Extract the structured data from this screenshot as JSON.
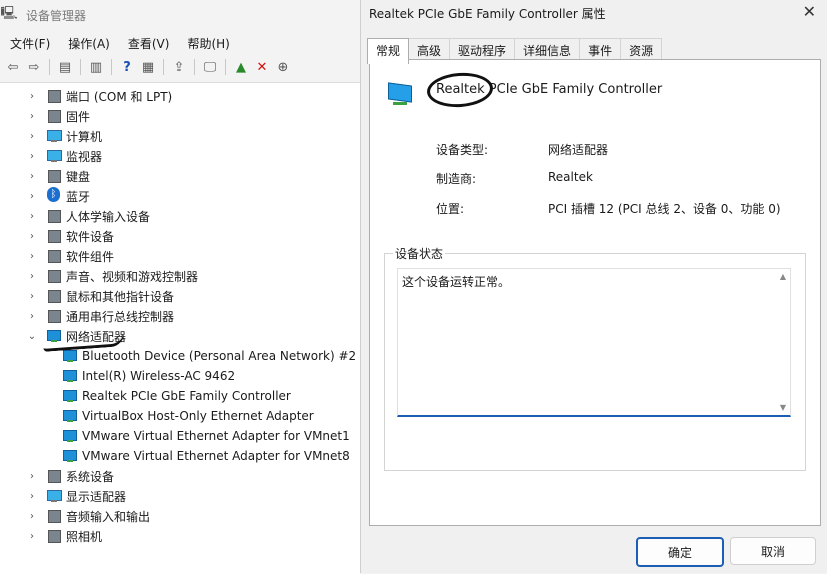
{
  "device_manager": {
    "title": "设备管理器",
    "menu": [
      "文件(F)",
      "操作(A)",
      "查看(V)",
      "帮助(H)"
    ],
    "categories": [
      {
        "label": "端口 (COM 和 LPT)",
        "icon": "port-icon"
      },
      {
        "label": "固件",
        "icon": "firmware-icon"
      },
      {
        "label": "计算机",
        "icon": "computer-icon"
      },
      {
        "label": "监视器",
        "icon": "monitor-icon"
      },
      {
        "label": "键盘",
        "icon": "keyboard-icon"
      },
      {
        "label": "蓝牙",
        "icon": "bluetooth-icon"
      },
      {
        "label": "人体学输入设备",
        "icon": "hid-icon"
      },
      {
        "label": "软件设备",
        "icon": "software-device-icon"
      },
      {
        "label": "软件组件",
        "icon": "software-component-icon"
      },
      {
        "label": "声音、视频和游戏控制器",
        "icon": "audio-icon"
      },
      {
        "label": "鼠标和其他指针设备",
        "icon": "mouse-icon"
      },
      {
        "label": "通用串行总线控制器",
        "icon": "usb-icon"
      },
      {
        "label": "网络适配器",
        "icon": "network-adapter-icon"
      },
      {
        "label": "系统设备",
        "icon": "system-device-icon"
      },
      {
        "label": "显示适配器",
        "icon": "display-adapter-icon"
      },
      {
        "label": "音频输入和输出",
        "icon": "audio-io-icon"
      },
      {
        "label": "照相机",
        "icon": "camera-icon"
      }
    ],
    "network_children": [
      "Bluetooth Device (Personal Area Network) #2",
      "Intel(R) Wireless-AC 9462",
      "Realtek PCIe GbE Family Controller",
      "VirtualBox Host-Only Ethernet Adapter",
      "VMware Virtual Ethernet Adapter for VMnet1",
      "VMware Virtual Ethernet Adapter for VMnet8"
    ]
  },
  "properties_dialog": {
    "title": "Realtek PCIe GbE Family Controller 属性",
    "tabs": [
      "常规",
      "高级",
      "驱动程序",
      "详细信息",
      "事件",
      "资源"
    ],
    "device_name": "Realtek PCIe GbE Family Controller",
    "device_type_label": "设备类型:",
    "device_type_value": "网络适配器",
    "manufacturer_label": "制造商:",
    "manufacturer_value": "Realtek",
    "location_label": "位置:",
    "location_value": "PCI 插槽 12 (PCI 总线 2、设备 0、功能 0)",
    "status_group_label": "设备状态",
    "status_text": "这个设备运转正常。",
    "ok_label": "确定",
    "cancel_label": "取消"
  }
}
